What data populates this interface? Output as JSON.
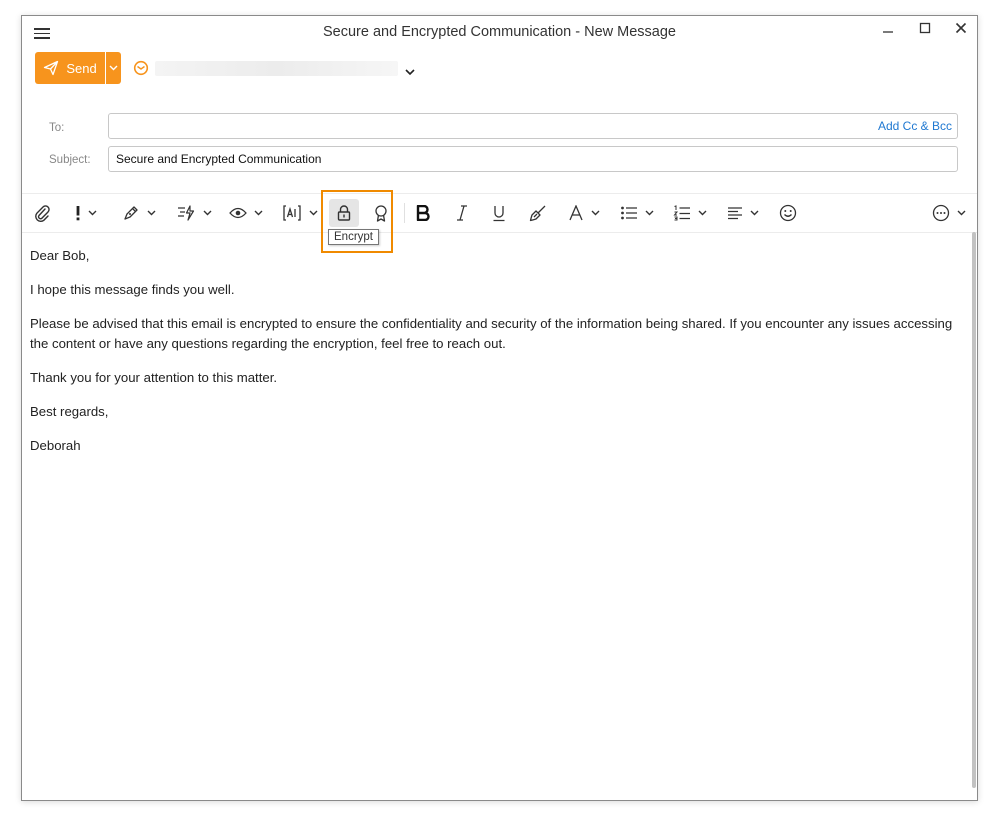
{
  "window": {
    "title": "Secure and Encrypted Communication - New Message"
  },
  "send": {
    "label": "Send"
  },
  "fields": {
    "to_label": "To:",
    "to_value": "",
    "add_cc_bcc": "Add Cc & Bcc",
    "subject_label": "Subject:",
    "subject_value": "Secure and Encrypted Communication"
  },
  "toolbar": {
    "tooltip": "Encrypt",
    "items": [
      "attach-icon",
      "priority-icon",
      "signature-icon",
      "templates-icon",
      "read-receipt-icon",
      "ai-icon",
      "lock-icon",
      "certificate-icon",
      "bold-icon",
      "italic-icon",
      "underline-icon",
      "format-painter-icon",
      "font-color-icon",
      "bullets-icon",
      "numbering-icon",
      "align-icon",
      "emoji-icon",
      "more-icon"
    ]
  },
  "message": {
    "paragraphs": [
      "Dear Bob,",
      "I hope this message finds you well.",
      "Please be advised that this email is encrypted to ensure the confidentiality and security of the information being shared. If you encounter any issues accessing the content or have any questions regarding the encryption, feel free to reach out.",
      "Thank you for your attention to this matter.",
      "Best regards,",
      "Deborah"
    ]
  },
  "colors": {
    "accent": "#f7941d",
    "link": "#1f78d1",
    "highlight": "#f08a00"
  }
}
